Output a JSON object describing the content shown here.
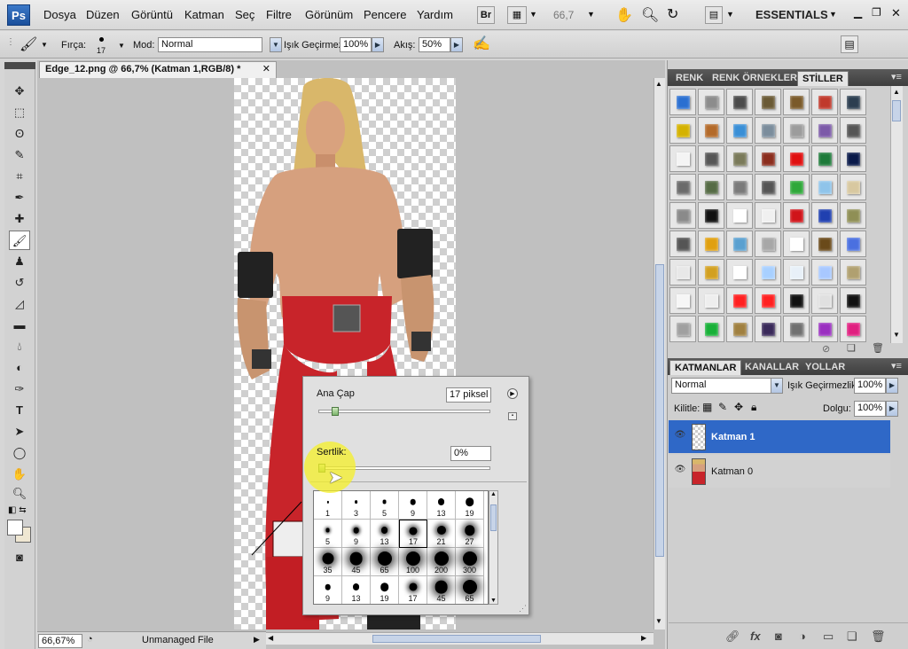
{
  "app": {
    "logo": "Ps"
  },
  "menu": [
    "Dosya",
    "Düzen",
    "Görüntü",
    "Katman",
    "Seç",
    "Filtre",
    "Görünüm",
    "Pencere",
    "Yardım"
  ],
  "menubar": {
    "br_label": "Br",
    "zoom": "66,7",
    "workspace": "ESSENTIALS"
  },
  "options": {
    "brush_label": "Fırça:",
    "brush_size": "17",
    "mode_label": "Mod:",
    "mode_value": "Normal",
    "opacity_label": "Işık Geçirmezlik:",
    "opacity_value": "100%",
    "flow_label": "Akış:",
    "flow_value": "50%"
  },
  "document": {
    "tab_title": "Edge_12.png @ 66,7% (Katman 1,RGB/8) *",
    "close": "✕",
    "zoom": "66,67%",
    "status": "Unmanaged File"
  },
  "brush_panel": {
    "diameter_label": "Ana Çap",
    "diameter_value": "17 piksel",
    "diameter_fraction": 0.08,
    "hardness_label": "Sertlik:",
    "hardness_value": "0%",
    "hardness_fraction": 0.0,
    "presets": [
      {
        "size": "1",
        "kind": "hard"
      },
      {
        "size": "3",
        "kind": "hard"
      },
      {
        "size": "5",
        "kind": "hard"
      },
      {
        "size": "9",
        "kind": "hard"
      },
      {
        "size": "13",
        "kind": "hard"
      },
      {
        "size": "19",
        "kind": "hard"
      },
      {
        "size": "5",
        "kind": "soft"
      },
      {
        "size": "9",
        "kind": "soft"
      },
      {
        "size": "13",
        "kind": "soft"
      },
      {
        "size": "17",
        "kind": "soft",
        "selected": true
      },
      {
        "size": "21",
        "kind": "soft"
      },
      {
        "size": "27",
        "kind": "soft"
      },
      {
        "size": "35",
        "kind": "soft"
      },
      {
        "size": "45",
        "kind": "soft"
      },
      {
        "size": "65",
        "kind": "soft"
      },
      {
        "size": "100",
        "kind": "soft"
      },
      {
        "size": "200",
        "kind": "soft"
      },
      {
        "size": "300",
        "kind": "soft"
      },
      {
        "size": "9",
        "kind": "hard"
      },
      {
        "size": "13",
        "kind": "hard"
      },
      {
        "size": "19",
        "kind": "hard"
      },
      {
        "size": "17",
        "kind": "soft"
      },
      {
        "size": "45",
        "kind": "soft"
      },
      {
        "size": "65",
        "kind": "soft"
      }
    ]
  },
  "panels": {
    "top_tabs": [
      "RENK",
      "RENK ÖRNEKLERİ",
      "STİLLER"
    ],
    "layer_tabs": [
      "KATMANLAR",
      "KANALLAR",
      "YOLLAR"
    ],
    "styles": [
      "#2a6fd1",
      "#8c8c8c",
      "#4b4b4b",
      "#6a5a35",
      "#7a5a2a",
      "#c0392b",
      "#2c3e50",
      "#d4b200",
      "#b36a2a",
      "#3a8fd6",
      "#7b8d9c",
      "#9c9c9c",
      "#7c5aa8",
      "#555555",
      "#f4f4f4",
      "#555555",
      "#7a7a5a",
      "#8b2e1e",
      "#e01010",
      "#1e7a3a",
      "#0a1a4a",
      "#6b6b6b",
      "#556b45",
      "#7a7a7a",
      "#555555",
      "#2fa83a",
      "#8fc4ea",
      "#d8c8a0",
      "#8a8a8a",
      "#111111",
      "#ffffff",
      "#f0f0f0",
      "#d0141a",
      "#2040b0",
      "#8f8f55",
      "#555555",
      "#e0a010",
      "#5aa0d0",
      "#a7a7a7",
      "#ffffff",
      "#6a4a1a",
      "#4a70e0",
      "#e8e8e8",
      "#d2a020",
      "#ffffff",
      "#a8d0ff",
      "#e8f0f8",
      "#a8c8ff",
      "#b0a070",
      "#f6f6f6",
      "#eeeeee",
      "#ff2020",
      "#ff2020",
      "#111111",
      "#e0e0e0",
      "#111111",
      "#a0a0a0",
      "#18b038",
      "#a08040",
      "#3a2a5a",
      "#707070",
      "#9a30c0",
      "#e02080"
    ],
    "layers_panel": {
      "blend": "Normal",
      "opacity_label": "Işık Geçirmezlik:",
      "opacity": "100%",
      "lock_label": "Kilitle:",
      "fill_label": "Dolgu:",
      "fill": "100%",
      "layers": [
        {
          "name": "Katman 1",
          "selected": true
        },
        {
          "name": "Katman 0",
          "selected": false
        }
      ]
    }
  }
}
